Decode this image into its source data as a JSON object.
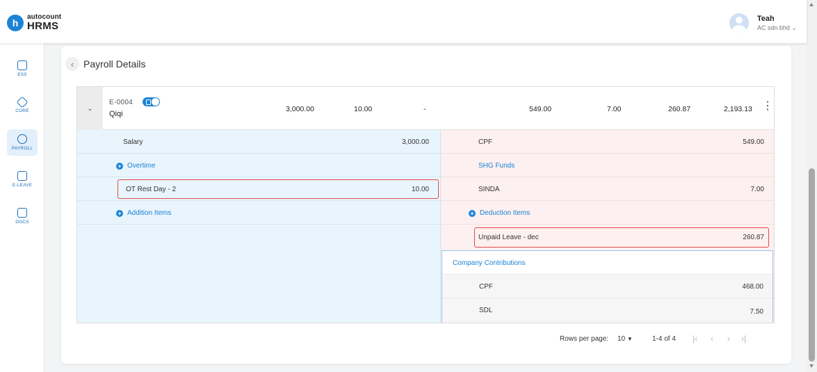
{
  "header": {
    "logo_mark": "h",
    "logo_top": "autocount",
    "logo_bottom": "HRMS",
    "user_name": "Teah",
    "company": "AC sdn bhd"
  },
  "sidebar": {
    "items": [
      {
        "label": "ESS",
        "icon": "ess-icon"
      },
      {
        "label": "CORE",
        "icon": "core-icon"
      },
      {
        "label": "PAYROLL",
        "icon": "payroll-icon",
        "active": true
      },
      {
        "label": "E-LEAVE",
        "icon": "calendar-icon"
      },
      {
        "label": "DOCS",
        "icon": "docs-icon"
      }
    ]
  },
  "page": {
    "title": "Payroll Details"
  },
  "employee": {
    "code": "E-0004",
    "name": "Qiqi",
    "basic": "3,000.00",
    "overtime": "10.00",
    "addition": "-",
    "cpf": "549.00",
    "shg": "7.00",
    "deduction": "260.87",
    "net": "2,193.13"
  },
  "earnings": {
    "salary_label": "Salary",
    "salary_value": "3,000.00",
    "overtime_label": "Overtime",
    "ot_item_label": "OT Rest Day - 2",
    "ot_item_value": "10.00",
    "addition_label": "Addition Items"
  },
  "deductions": {
    "cpf_label": "CPF",
    "cpf_value": "549.00",
    "shg_label": "SHG Funds",
    "sinda_label": "SINDA",
    "sinda_value": "7.00",
    "deduction_label": "Deduction Items",
    "unpaid_label": "Unpaid Leave - dec",
    "unpaid_value": "260.87"
  },
  "company_contributions": {
    "title": "Company Contributions",
    "cpf_label": "CPF",
    "cpf_value": "468.00",
    "sdl_label": "SDL",
    "sdl_value": "7.50"
  },
  "pagination": {
    "rows_label": "Rows per page:",
    "rows_value": "10",
    "range": "1-4 of 4"
  },
  "colors": {
    "accent": "#1b83d6",
    "earnings_bg": "#e9f5fc",
    "deductions_bg": "#fdf0f0",
    "highlight": "#e14b4b"
  }
}
